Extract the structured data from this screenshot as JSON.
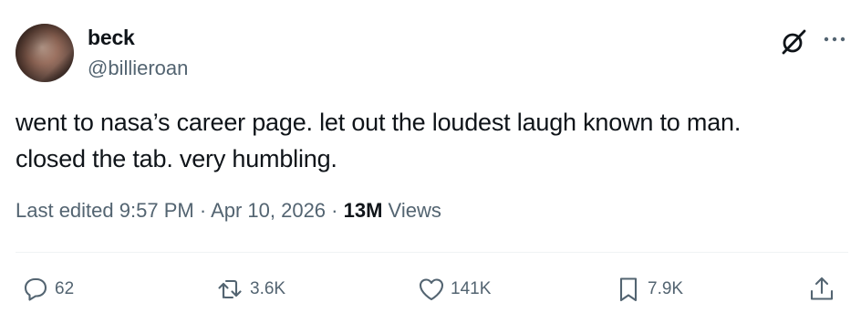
{
  "author": {
    "display_name": "beck",
    "handle": "@billieroan"
  },
  "tweet": {
    "lines": [
      "went to nasa’s career page. let out the loudest laugh known to man.",
      "closed the tab. very humbling."
    ]
  },
  "meta": {
    "edited_label": "Last edited",
    "time": "9:57 PM",
    "separator": "·",
    "date": "Apr 10, 2026",
    "views_count": "13M",
    "views_label": "Views"
  },
  "actions": {
    "replies": "62",
    "reposts": "3.6K",
    "likes": "141K",
    "bookmarks": "7.9K"
  },
  "icons": {
    "grok": "grok-icon",
    "more": "more-icon",
    "reply": "reply-icon",
    "repost": "repost-icon",
    "like": "heart-icon",
    "bookmark": "bookmark-icon",
    "share": "share-icon"
  },
  "colors": {
    "text": "#0f1419",
    "secondary": "#536471",
    "divider": "#eff3f4"
  }
}
